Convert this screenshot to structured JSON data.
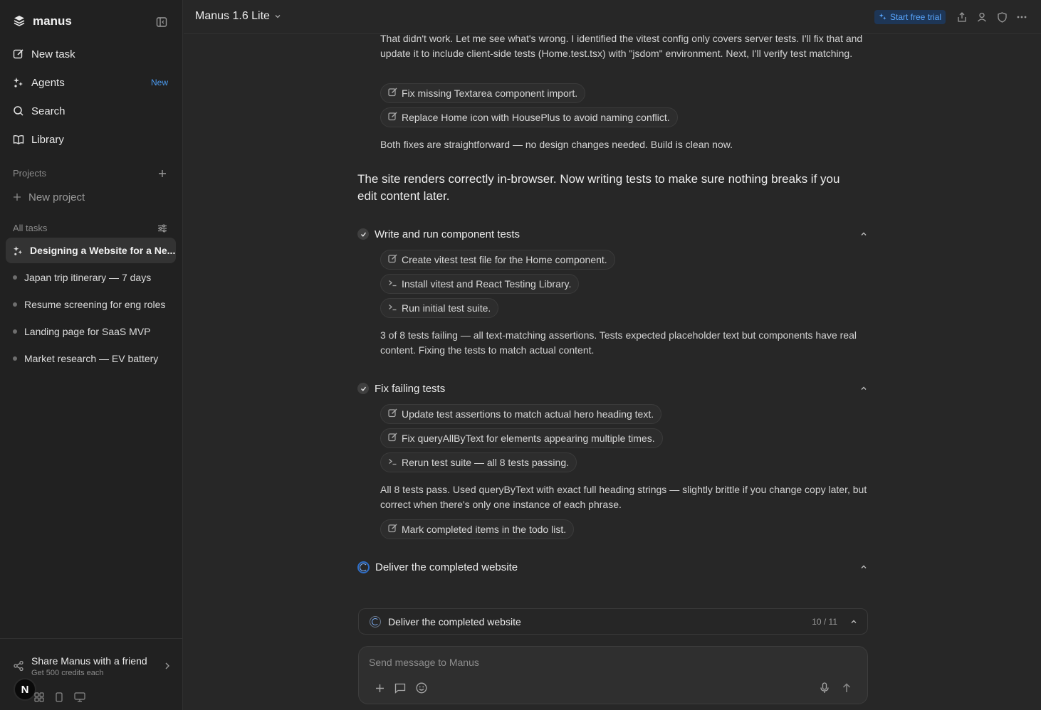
{
  "sidebar": {
    "brand": "manus",
    "nav": [
      {
        "label": "New task",
        "icon": "new-task-icon"
      },
      {
        "label": "Agents",
        "icon": "agents-icon",
        "badge": "New"
      },
      {
        "label": "Search",
        "icon": "search-icon"
      },
      {
        "label": "Library",
        "icon": "library-icon"
      }
    ],
    "projects_label": "Projects",
    "new_project_label": "New project",
    "all_tasks_label": "All tasks",
    "active_task": "Designing a Website for a Ne...",
    "tasks": [
      "Japan trip itinerary — 7 days",
      "Resume screening for eng roles",
      "Landing page for SaaS MVP",
      "Market research — EV battery"
    ],
    "share_title": "Share Manus with a friend",
    "share_subtitle": "Get 500 credits each",
    "avatar_initial": "N"
  },
  "topbar": {
    "model": "Manus 1.6 Lite",
    "trial_label": "Start free trial"
  },
  "content": {
    "intro_para": "That didn't work. Let me see what's wrong. I identified the vitest config only covers server tests. I'll fix that and update it to include client-side tests (Home.test.tsx) with \"jsdom\" environment. Next, I'll verify test matching.",
    "chips_a": [
      "Fix missing Textarea component import.",
      "Replace Home icon with HousePlus to avoid naming conflict."
    ],
    "fix_note": "Both fixes are straightforward — no design changes needed. Build is clean now.",
    "big_para": "The site renders correctly in-browser. Now writing tests to make sure nothing breaks if you edit content later.",
    "step1_title": "Write and run component tests",
    "step1_chips": [
      "Create vitest test file for the Home component.",
      "Install vitest and React Testing Library.",
      "Run initial test suite."
    ],
    "step1_note": "3 of 8 tests failing — all text-matching assertions. Tests expected placeholder text but components have real content. Fixing the tests to match actual content.",
    "step2_title": "Fix failing tests",
    "step2_chips": [
      "Update test assertions to match actual hero heading text.",
      "Fix queryAllByText for elements appearing multiple times.",
      "Rerun test suite — all 8 tests passing."
    ],
    "step2_note": "All 8 tests pass. Used queryByText with exact full heading strings — slightly brittle if you change copy later, but correct when there's only one instance of each phrase.",
    "step2_final_chip": "Mark completed items in the todo list.",
    "step3_title": "Deliver the completed website"
  },
  "progress": {
    "label": "Deliver the completed website",
    "count": "10 / 11"
  },
  "composer": {
    "placeholder": "Send message to Manus"
  },
  "colors": {
    "accent": "#4b9bf0",
    "background": "#272727",
    "sidebar": "#212121"
  }
}
